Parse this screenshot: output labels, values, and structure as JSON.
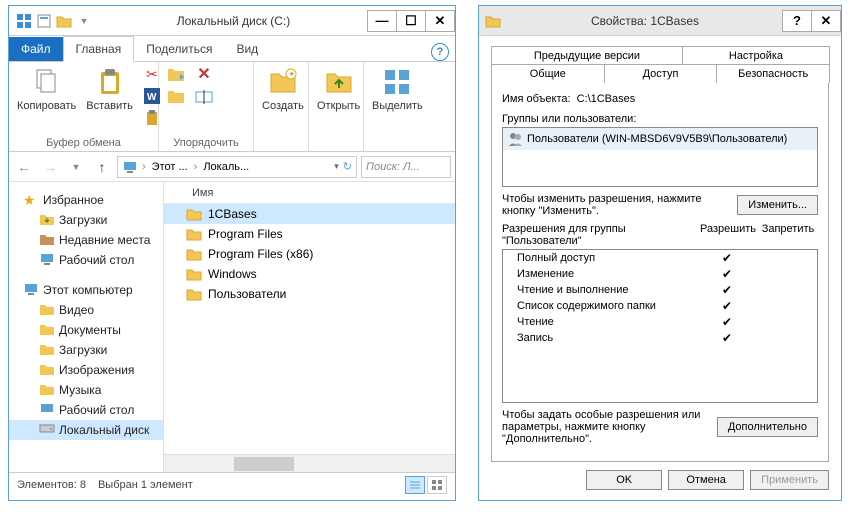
{
  "explorer": {
    "title": "Локальный диск (C:)",
    "tabs": {
      "file": "Файл",
      "home": "Главная",
      "share": "Поделиться",
      "view": "Вид"
    },
    "ribbon": {
      "copy": "Копировать",
      "paste": "Вставить",
      "clipboard_group": "Буфер обмена",
      "organize_group": "Упорядочить",
      "create": "Создать",
      "open": "Открыть",
      "select": "Выделить"
    },
    "breadcrumb": {
      "this": "Этот ...",
      "local": "Локаль..."
    },
    "search_placeholder": "Поиск: Л...",
    "nav": {
      "favorites": "Избранное",
      "downloads": "Загрузки",
      "recent": "Недавние места",
      "desktop": "Рабочий стол",
      "thispc": "Этот компьютер",
      "video": "Видео",
      "documents": "Документы",
      "downloads2": "Загрузки",
      "pictures": "Изображения",
      "music": "Музыка",
      "desktop2": "Рабочий стол",
      "localdisk": "Локальный диск"
    },
    "list_header": "Имя",
    "items": [
      "1CBases",
      "Program Files",
      "Program Files (x86)",
      "Windows",
      "Пользователи"
    ],
    "status": {
      "items": "Элементов: 8",
      "selected": "Выбран 1 элемент"
    }
  },
  "props": {
    "title": "Свойства: 1CBases",
    "tabs": {
      "prev": "Предыдущие версии",
      "custom": "Настройка",
      "general": "Общие",
      "sharing": "Доступ",
      "security": "Безопасность"
    },
    "object_label": "Имя объекта:",
    "object_value": "C:\\1CBases",
    "groups_label": "Группы или пользователи:",
    "group_item": "Пользователи (WIN-MBSD6V9V5B9\\Пользователи)",
    "edit_hint": "Чтобы изменить разрешения, нажмите кнопку \"Изменить\".",
    "edit_btn": "Изменить...",
    "perm_label": "Разрешения для группы \"Пользователи\"",
    "allow": "Разрешить",
    "deny": "Запретить",
    "perms": [
      "Полный доступ",
      "Изменение",
      "Чтение и выполнение",
      "Список содержимого папки",
      "Чтение",
      "Запись"
    ],
    "adv_hint": "Чтобы задать особые разрешения или параметры, нажмите кнопку \"Дополнительно\".",
    "adv_btn": "Дополнительно",
    "ok": "OK",
    "cancel": "Отмена",
    "apply": "Применить"
  }
}
